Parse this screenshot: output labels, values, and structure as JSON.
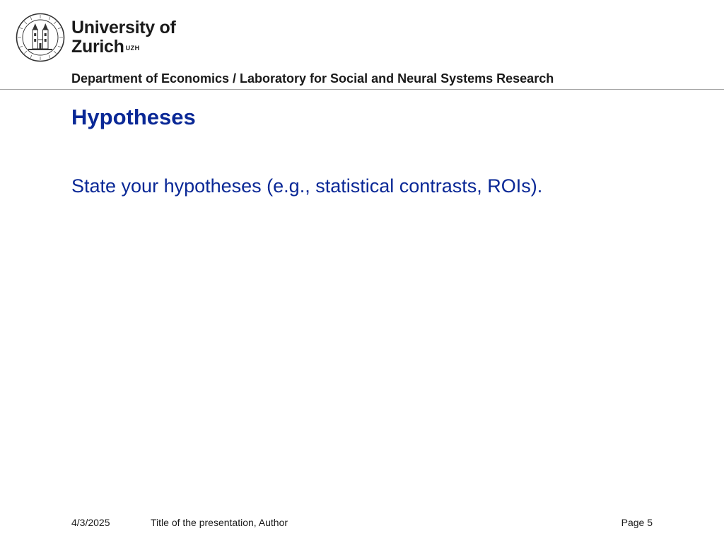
{
  "header": {
    "logo": {
      "icon": "university-seal-icon",
      "line1": "University of",
      "line2": "Zurich",
      "suffix": "UZH"
    },
    "department": "Department of Economics / Laboratory for Social and Neural Systems Research"
  },
  "slide": {
    "title": "Hypotheses",
    "body": "State your hypotheses (e.g., statistical contrasts, ROIs)."
  },
  "footer": {
    "date": "4/3/2025",
    "presentation": "Title of the presentation, Author",
    "page": "Page 5"
  },
  "colors": {
    "accent": "#0a2896",
    "text": "#1a1a1a",
    "divider": "#a6a6a6"
  }
}
